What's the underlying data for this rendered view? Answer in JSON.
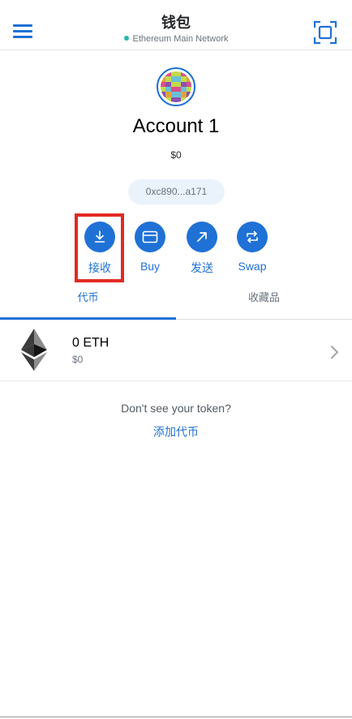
{
  "header": {
    "title": "钱包",
    "network": "Ethereum Main Network",
    "network_dot_color": "#29b6af",
    "menu_icon": "hamburger-icon",
    "scan_icon": "qr-scan-icon"
  },
  "account": {
    "name": "Account 1",
    "balance": "$0",
    "address": "0xc890...a171"
  },
  "actions": [
    {
      "label": "接收",
      "icon": "receive-icon"
    },
    {
      "label": "Buy",
      "icon": "card-icon"
    },
    {
      "label": "发送",
      "icon": "send-icon"
    },
    {
      "label": "Swap",
      "icon": "swap-icon"
    }
  ],
  "tabs": [
    {
      "label": "代币",
      "active": true
    },
    {
      "label": "收藏品",
      "active": false
    }
  ],
  "tokens": [
    {
      "amount": "0 ETH",
      "fiat": "$0",
      "icon": "eth-icon"
    }
  ],
  "empty_prompt": {
    "question": "Don't see your token?",
    "link": "添加代币"
  },
  "colors": {
    "accent": "#1f71d6",
    "highlight": "#e12a22"
  }
}
